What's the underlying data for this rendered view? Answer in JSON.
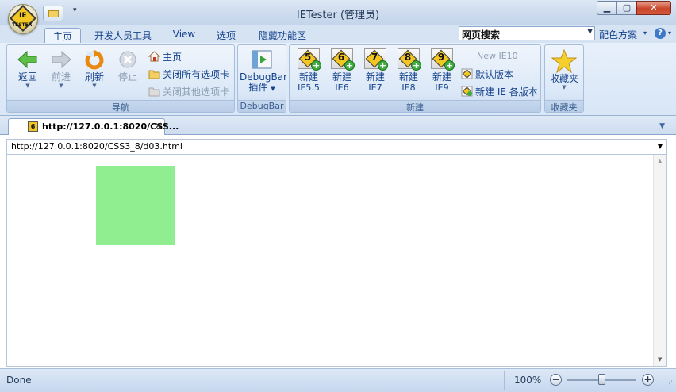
{
  "window": {
    "title": "IETester (管理员)",
    "logo_text_top": "IE",
    "logo_text_bottom": "TESTER",
    "qat_dropdown": "▾",
    "minimize": "▁",
    "maximize": "▢",
    "close": "✕"
  },
  "ribbon_tabs": [
    "主页",
    "开发人员工具",
    "View",
    "选项",
    "隐藏功能区"
  ],
  "search": {
    "value": "网页搜索"
  },
  "color_scheme": {
    "label": "配色方案",
    "arrow": "▾"
  },
  "help": {
    "glyph": "?",
    "arrow": "▾"
  },
  "nav_group": {
    "label": "导航",
    "back": "返回",
    "forward": "前进",
    "refresh": "刷新",
    "stop": "停止",
    "home": "主页",
    "close_all": "关闭所有选项卡",
    "close_others": "关闭其他选项卡"
  },
  "debugbar_group": {
    "label": "DebugBar",
    "button_line1": "DebugBar",
    "button_line2": "插件"
  },
  "new_group": {
    "label": "新建",
    "items": [
      {
        "num": "5",
        "line1": "新建",
        "line2": "IE5.5"
      },
      {
        "num": "6",
        "line1": "新建",
        "line2": "IE6"
      },
      {
        "num": "7",
        "line1": "新建",
        "line2": "IE7"
      },
      {
        "num": "8",
        "line1": "新建",
        "line2": "IE8"
      },
      {
        "num": "9",
        "line1": "新建",
        "line2": "IE9"
      }
    ],
    "new_ie10": "New IE10",
    "default_version": "默认版本",
    "all_versions": "新建 IE 各版本"
  },
  "favorites_group": {
    "label": "收藏夹",
    "button": "收藏夹"
  },
  "document_tab": {
    "icon_num": "6",
    "title": "http://127.0.0.1:8020/CSS...",
    "close": "✕"
  },
  "tabs_menu": "▼",
  "address_bar": {
    "value": "http://127.0.0.1:8020/CSS3_8/d03.html",
    "arrow": "▼"
  },
  "page": {
    "box_color": "#90ee90"
  },
  "status_bar": {
    "status": "Done",
    "zoom": "100%",
    "zoom_level": 100,
    "zoom_minus": "−",
    "zoom_plus": "+"
  }
}
